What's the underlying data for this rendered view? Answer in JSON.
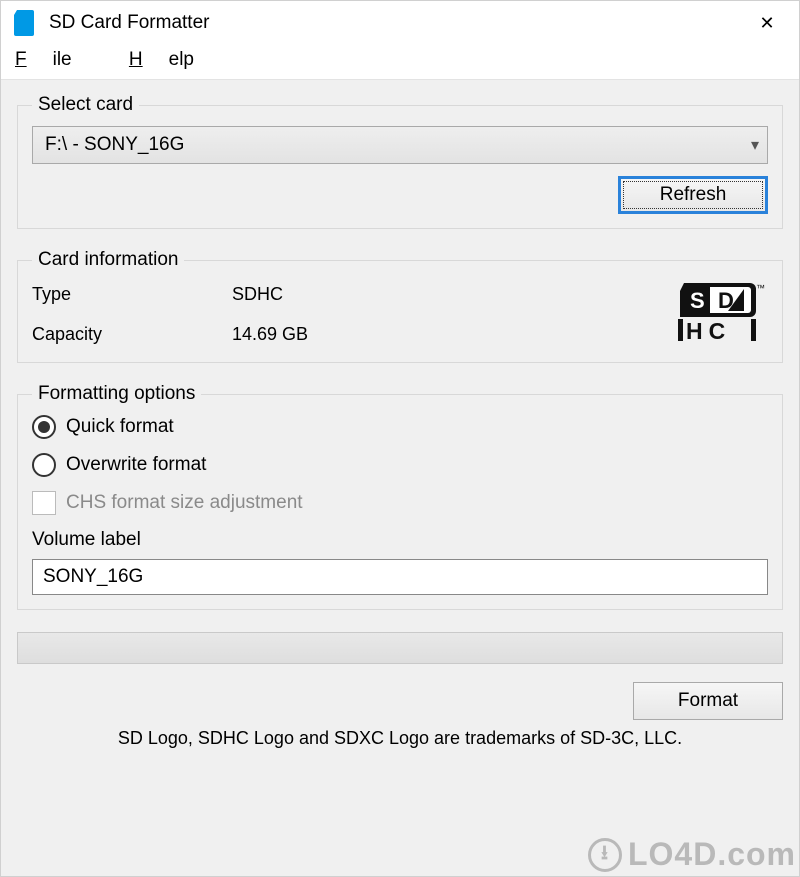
{
  "titlebar": {
    "title": "SD Card Formatter",
    "close_glyph": "✕"
  },
  "menu": {
    "file": "File",
    "help": "Help"
  },
  "select_card": {
    "legend": "Select card",
    "selected": "F:\\ - SONY_16G",
    "refresh_label": "Refresh"
  },
  "card_info": {
    "legend": "Card information",
    "type_label": "Type",
    "type_value": "SDHC",
    "capacity_label": "Capacity",
    "capacity_value": "14.69 GB",
    "logo_name": "SDHC"
  },
  "format_opts": {
    "legend": "Formatting options",
    "quick": "Quick format",
    "overwrite": "Overwrite format",
    "chs": "CHS format size adjustment",
    "selected": "quick",
    "vol_label_caption": "Volume label",
    "vol_label_value": "SONY_16G"
  },
  "buttons": {
    "format": "Format"
  },
  "footer": {
    "trademark": "SD Logo, SDHC Logo and SDXC Logo are trademarks of SD-3C, LLC."
  },
  "watermark": {
    "text": "LO4D.com"
  }
}
